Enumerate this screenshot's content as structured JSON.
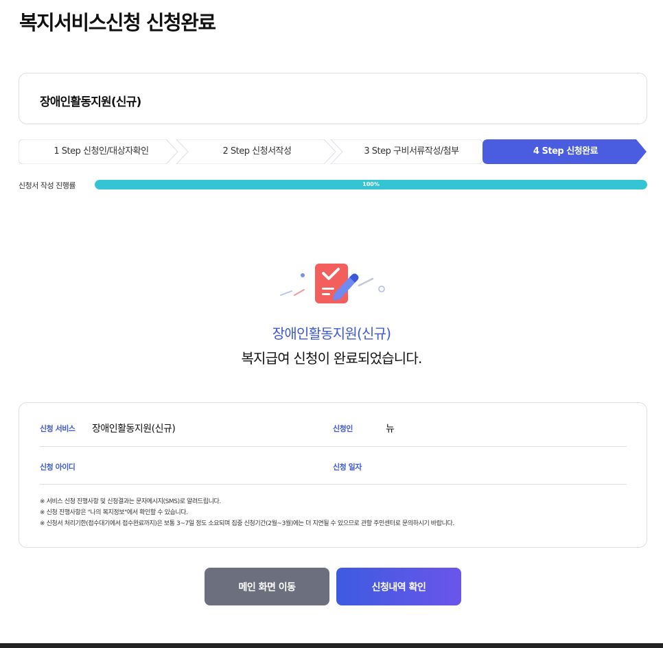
{
  "page": {
    "title": "복지서비스신청 신청완료"
  },
  "service": {
    "name": "장애인활동지원(신규)"
  },
  "steps": [
    {
      "label": "1 Step 신청인/대상자확인",
      "active": false
    },
    {
      "label": "2 Step 신청서작성",
      "active": false
    },
    {
      "label": "3 Step 구비서류작성/첨부",
      "active": false
    },
    {
      "label": "4 Step 신청완료",
      "active": true
    }
  ],
  "progress": {
    "label": "신청서 작성 진행률",
    "value": 100,
    "text": "100%"
  },
  "result": {
    "icon": "clipboard-check-icon",
    "service_name": "장애인활동지원(신규)",
    "message": "복지급여 신청이 완료되었습니다."
  },
  "info": {
    "service_label": "신청 서비스",
    "service_value": "장애인활동지원(신규)",
    "applicant_label": "신청인",
    "applicant_value": "뉴",
    "id_label": "신청 아이디",
    "date_label": "신청 일자",
    "notes": [
      "※ 서비스 신청 진행사항 및 신청결과는 문자메시지(SMS)로 알려드립니다.",
      "※ 신청 진행사항은 \"나의 복지정보\"에서 확인할 수 있습니다.",
      "※ 신청서 처리기한(접수대기에서 접수완료까지)은 보통 3~7일 정도 소요되며 집중 신청기간(2월~3월)에는 더 지연될 수 있으므로 관할 주민센터로 문의하시기 바랍니다."
    ]
  },
  "buttons": {
    "main": "메인 화면 이동",
    "history": "신청내역 확인"
  },
  "colors": {
    "accent": "#3d58d8",
    "progress": "#35c4d3",
    "gray_button": "#6c6f7e",
    "active_step": "#4a5de0"
  }
}
